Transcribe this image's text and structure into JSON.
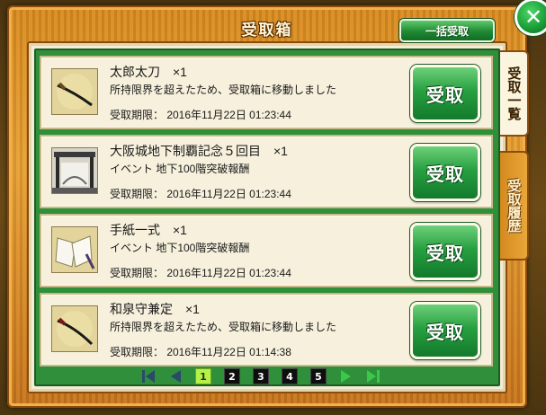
{
  "header": {
    "title": "受取箱",
    "bulk_receive_label": "一括受取",
    "close_symbol": "✕"
  },
  "tabs": [
    {
      "label": "受取一覧",
      "active": true
    },
    {
      "label": "受取履歴",
      "active": false
    }
  ],
  "items": [
    {
      "name": "太郎太刀　×1",
      "description": "所持限界を超えたため、受取箱に移動しました",
      "expire": "受取期限：  2016年11月22日 01:23:44",
      "button": "受取",
      "icon": "sword-icon"
    },
    {
      "name": "大阪城地下制覇記念５回目　×1",
      "description": "イベント 地下100階突破報酬",
      "expire": "受取期限：  2016年11月22日 01:23:44",
      "button": "受取",
      "icon": "castle-gate-icon"
    },
    {
      "name": "手紙一式　×1",
      "description": "イベント 地下100階突破報酬",
      "expire": "受取期限：  2016年11月22日 01:23:44",
      "button": "受取",
      "icon": "letter-set-icon"
    },
    {
      "name": "和泉守兼定　×1",
      "description": "所持限界を超えたため、受取箱に移動しました",
      "expire": "受取期限：  2016年11月22日 01:14:38",
      "button": "受取",
      "icon": "sword-icon"
    }
  ],
  "pagination": {
    "pages": [
      "1",
      "2",
      "3",
      "4",
      "5"
    ],
    "current": "1"
  },
  "colors": {
    "frame": "#e09a2c",
    "list_bg": "#2f8f3a",
    "button_green": "#27a040",
    "current_page": "#b8f04a"
  }
}
